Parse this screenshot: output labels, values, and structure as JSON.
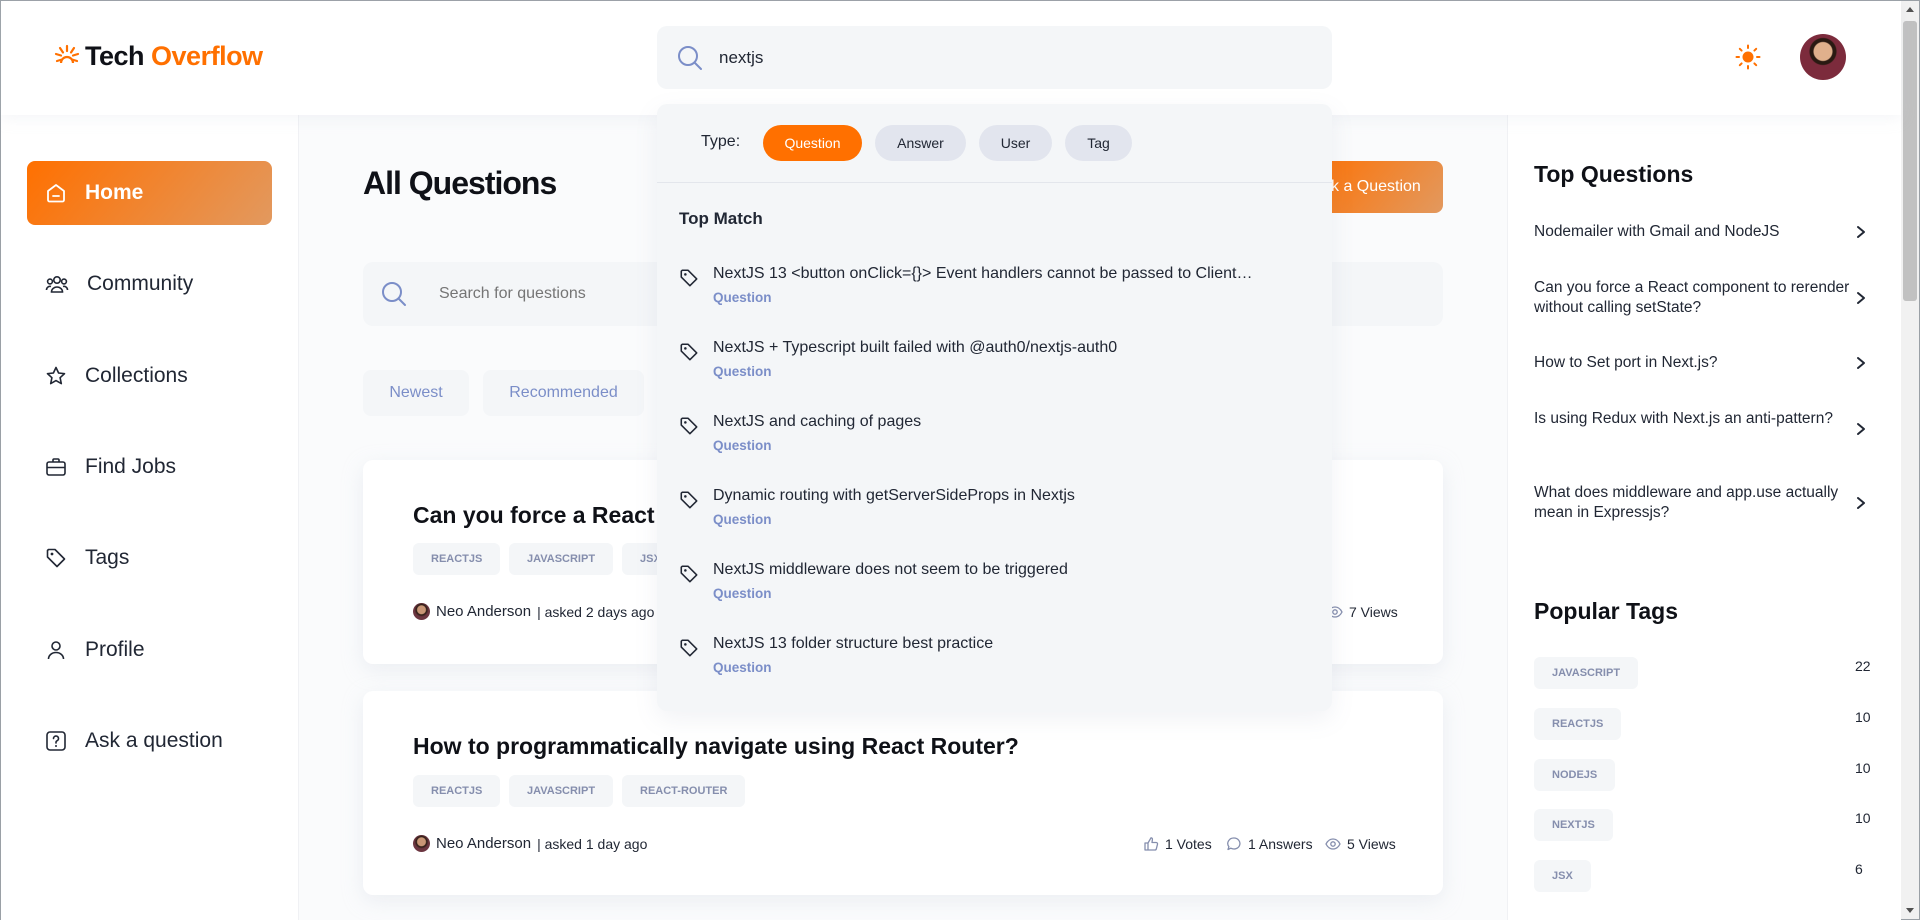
{
  "navbar": {
    "logo_a": "Tech",
    "logo_b": "Overflow",
    "search_value": "nextjs"
  },
  "sidebar": {
    "items": [
      {
        "label": "Home"
      },
      {
        "label": "Community"
      },
      {
        "label": "Collections"
      },
      {
        "label": "Find Jobs"
      },
      {
        "label": "Tags"
      },
      {
        "label": "Profile"
      },
      {
        "label": "Ask a question"
      }
    ]
  },
  "main": {
    "title": "All Questions",
    "ask_button": "sk a Question",
    "search_placeholder": "Search for questions",
    "filters": [
      "Newest",
      "Recommended"
    ],
    "questions": [
      {
        "title": "Can you force a React c",
        "tags": [
          "REACTJS",
          "JAVASCRIPT",
          "JSX"
        ],
        "author": "Neo Anderson",
        "asked": "| asked 2 days ago",
        "views": "7 Views"
      },
      {
        "title": "How to programmatically navigate using React Router?",
        "tags": [
          "REACTJS",
          "JAVASCRIPT",
          "REACT-ROUTER"
        ],
        "author": "Neo Anderson",
        "asked": "| asked 1 day ago",
        "votes": "1 Votes",
        "answers": "1 Answers",
        "views": "5 Views"
      }
    ]
  },
  "search_dropdown": {
    "type_label": "Type:",
    "types": [
      "Question",
      "Answer",
      "User",
      "Tag"
    ],
    "active_type": "Question",
    "top_match_label": "Top Match",
    "results": [
      {
        "title": "NextJS 13 <button onClick={}> Event handlers cannot be passed to Client…",
        "type": "Question"
      },
      {
        "title": "NextJS + Typescript built failed with @auth0/nextjs-auth0",
        "type": "Question"
      },
      {
        "title": "NextJS and caching of pages",
        "type": "Question"
      },
      {
        "title": "Dynamic routing with getServerSideProps in Nextjs",
        "type": "Question"
      },
      {
        "title": "NextJS middleware does not seem to be triggered",
        "type": "Question"
      },
      {
        "title": "NextJS 13 folder structure best practice",
        "type": "Question"
      }
    ]
  },
  "right_sidebar": {
    "top_questions_title": "Top Questions",
    "top_questions": [
      "Nodemailer with Gmail and NodeJS",
      "Can you force a React component to rerender without calling setState?",
      "How to Set port in Next.js?",
      "Is using Redux with Next.js an anti-pattern?",
      "What does middleware and app.use actually mean in Expressjs?"
    ],
    "popular_tags_title": "Popular Tags",
    "popular_tags": [
      {
        "name": "JAVASCRIPT",
        "count": "22"
      },
      {
        "name": "REACTJS",
        "count": "10"
      },
      {
        "name": "NODEJS",
        "count": "10"
      },
      {
        "name": "NEXTJS",
        "count": "10"
      },
      {
        "name": "JSX",
        "count": "6"
      }
    ]
  },
  "colors": {
    "accent": "#ff7000",
    "accent_light": "#e2995f",
    "muted_blue": "#7b8ec8",
    "surface": "#f4f6f8"
  }
}
